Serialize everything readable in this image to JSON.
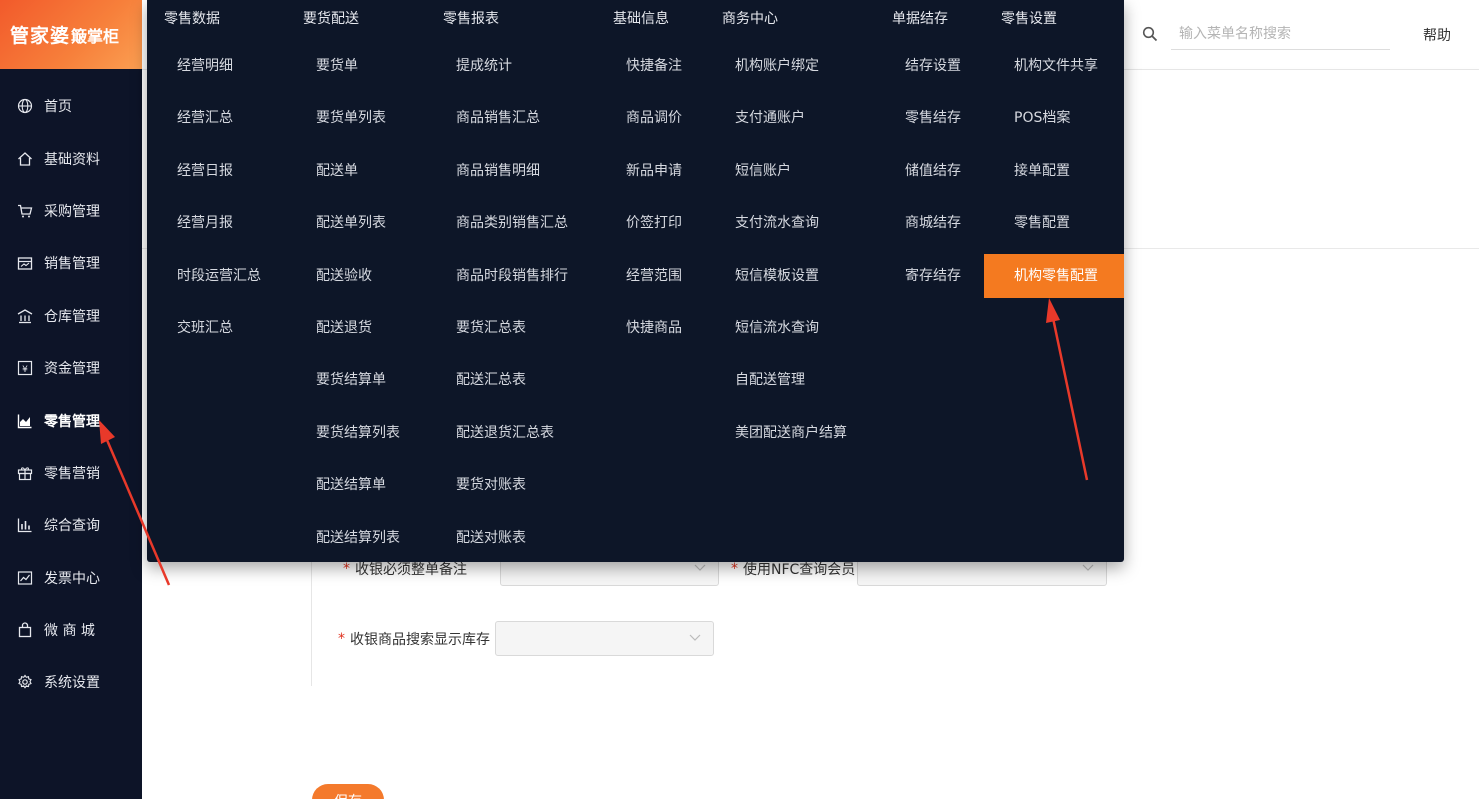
{
  "logo": {
    "brand": "管家婆",
    "product": "簸掌柜"
  },
  "sidebar": {
    "items": [
      {
        "label": "首页",
        "icon": "globe-icon"
      },
      {
        "label": "基础资料",
        "icon": "home-icon"
      },
      {
        "label": "采购管理",
        "icon": "cart-icon"
      },
      {
        "label": "销售管理",
        "icon": "sales-icon"
      },
      {
        "label": "仓库管理",
        "icon": "warehouse-icon"
      },
      {
        "label": "资金管理",
        "icon": "yen-icon"
      },
      {
        "label": "零售管理",
        "icon": "chart-area-icon",
        "active": true
      },
      {
        "label": "零售营销",
        "icon": "gift-icon"
      },
      {
        "label": "综合查询",
        "icon": "bar-chart-icon"
      },
      {
        "label": "发票中心",
        "icon": "trend-icon"
      },
      {
        "label": "微 商 城",
        "icon": "bag-icon"
      },
      {
        "label": "系统设置",
        "icon": "gear-icon"
      }
    ]
  },
  "header": {
    "search_placeholder": "输入菜单名称搜索",
    "help": "帮助"
  },
  "mega_menu": {
    "columns": [
      {
        "title": "零售数据",
        "items": [
          "经营明细",
          "经营汇总",
          "经营日报",
          "经营月报",
          "时段运营汇总",
          "交班汇总"
        ]
      },
      {
        "title": "要货配送",
        "items": [
          "要货单",
          "要货单列表",
          "配送单",
          "配送单列表",
          "配送验收",
          "配送退货",
          "要货结算单",
          "要货结算列表",
          "配送结算单",
          "配送结算列表"
        ]
      },
      {
        "title": "零售报表",
        "items": [
          "提成统计",
          "商品销售汇总",
          "商品销售明细",
          "商品类别销售汇总",
          "商品时段销售排行",
          "要货汇总表",
          "配送汇总表",
          "配送退货汇总表",
          "要货对账表",
          "配送对账表"
        ]
      },
      {
        "title": "基础信息",
        "items": [
          "快捷备注",
          "商品调价",
          "新品申请",
          "价签打印",
          "经营范围",
          "快捷商品"
        ]
      },
      {
        "title": "商务中心",
        "items": [
          "机构账户绑定",
          "支付通账户",
          "短信账户",
          "支付流水查询",
          "短信模板设置",
          "短信流水查询",
          "自配送管理",
          "美团配送商户结算"
        ]
      },
      {
        "title": "单据结存",
        "items": [
          "结存设置",
          "零售结存",
          "储值结存",
          "商城结存",
          "寄存结存"
        ]
      },
      {
        "title": "零售设置",
        "items": [
          "机构文件共享",
          "POS档案",
          "接单配置",
          "零售配置",
          "机构零售配置"
        ],
        "highlighted": "机构零售配置"
      }
    ]
  },
  "form": {
    "row1_left_label": "收银必须整单备注",
    "row1_right_label": "使用NFC查询会员",
    "row2_left_label": "收银商品搜索显示库存"
  },
  "save_button": "保存",
  "colors": {
    "accent": "#f47a20",
    "menu_bg": "#0d1628",
    "arrow": "#e8392a"
  }
}
